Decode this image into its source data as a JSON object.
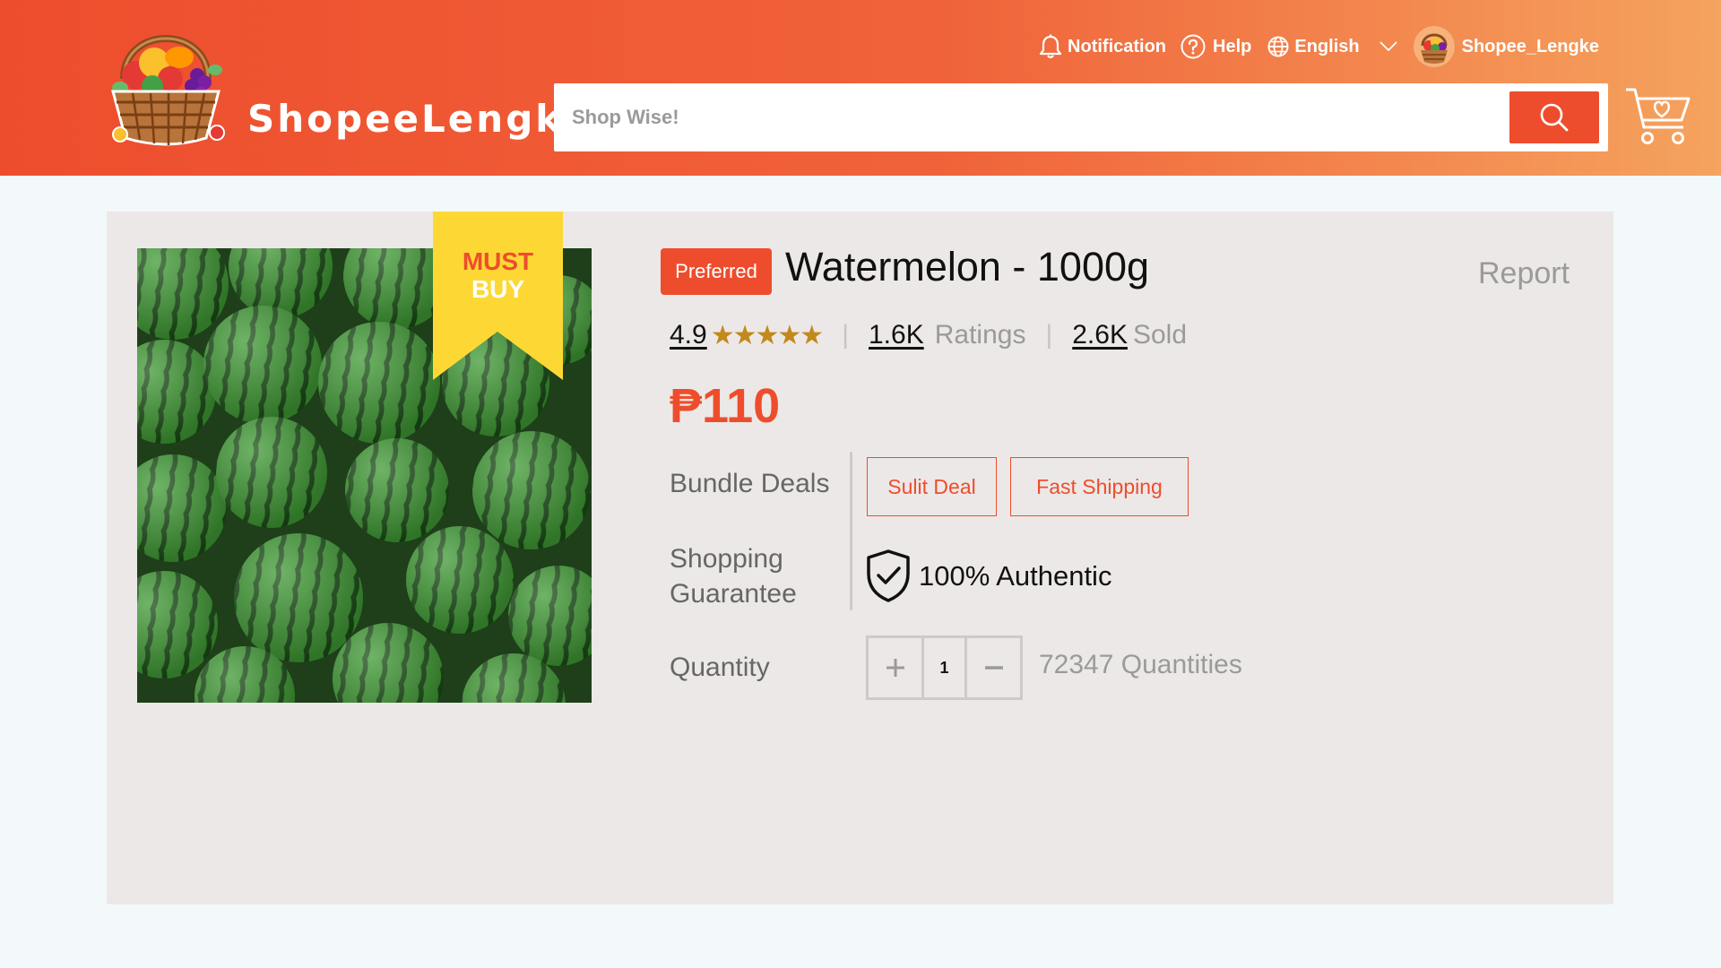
{
  "header": {
    "brand": "ShopeeLengke",
    "nav": {
      "notification": "Notification",
      "help": "Help",
      "language": "English",
      "username": "Shopee_Lengke"
    },
    "search": {
      "placeholder": "Shop Wise!"
    },
    "icons": [
      "fruit-basket-logo",
      "bell-icon",
      "help-icon",
      "globe-icon",
      "chevron-down-icon",
      "avatar",
      "search-icon",
      "cart-heart-icon"
    ]
  },
  "product": {
    "ribbon": {
      "line1": "MUST",
      "line2": "BUY"
    },
    "badge": "Preferred",
    "title": "Watermelon - 1000g",
    "report": "Report",
    "rating": "4.9",
    "stars": "★★★★★",
    "rating_count": "1.6K",
    "ratings_label": "Ratings",
    "sold_count": "2.6K",
    "sold_label": "Sold",
    "price": "₱110",
    "bundle_label": "Bundle Deals",
    "deals": [
      "Sulit Deal",
      "Fast Shipping"
    ],
    "guarantee_label_1": "Shopping",
    "guarantee_label_2": "Guarantee",
    "guarantee_text": "100% Authentic",
    "quantity_label": "Quantity",
    "quantity_value": "1",
    "stock_text": "72347 Quantities"
  },
  "colors": {
    "accent": "#ee4d2d",
    "header_gradient_end": "#f5a35e",
    "star": "#c2891d",
    "ribbon": "#fdd835",
    "card_bg": "#ece8e7",
    "page_bg": "#f3f9fb"
  }
}
